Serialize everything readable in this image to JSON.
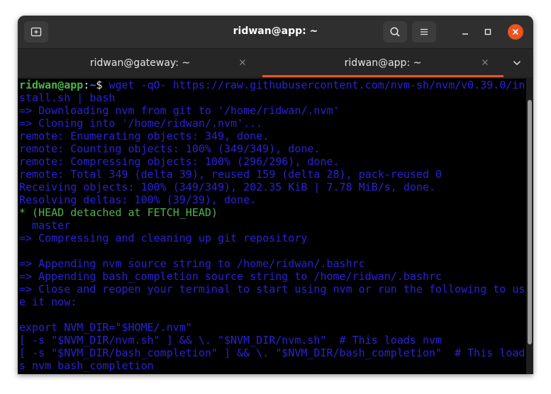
{
  "window": {
    "title": "ridwan@app: ~"
  },
  "header": {
    "newtab_icon": "new-tab-icon",
    "search_icon": "search-icon",
    "menu_icon": "hamburger-menu-icon"
  },
  "tabs": [
    {
      "label": "ridwan@gateway: ~",
      "active": false
    },
    {
      "label": "ridwan@app: ~",
      "active": true
    }
  ],
  "colors": {
    "accent": "#e95420",
    "terminal_bg": "#000000",
    "text_blue": "#2b21d6",
    "prompt_green": "#4eb44e"
  },
  "terminal": {
    "prompt_user": "ridwan@app",
    "prompt_sep": ":",
    "prompt_path": "~",
    "prompt_symbol": "$ ",
    "command_1": "wget -qO- https://raw.githubusercontent.com/nvm-sh/nvm/v0.39.0/in",
    "command_2": "stall.sh | bash",
    "lines": [
      "=> Downloading nvm from git to '/home/ridwan/.nvm'",
      "=> Cloning into '/home/ridwan/.nvm'...",
      "remote: Enumerating objects: 349, done.",
      "remote: Counting objects: 100% (349/349), done.",
      "remote: Compressing objects: 100% (296/296), done.",
      "remote: Total 349 (delta 39), reused 159 (delta 28), pack-reused 0",
      "Receiving objects: 100% (349/349), 202.35 KiB | 7.78 MiB/s, done.",
      "Resolving deltas: 100% (39/39), done.",
      "* (HEAD detached at FETCH_HEAD)",
      "  master",
      "=> Compressing and cleaning up git repository",
      "",
      "=> Appending nvm source string to /home/ridwan/.bashrc",
      "=> Appending bash_completion source string to /home/ridwan/.bashrc",
      "=> Close and reopen your terminal to start using nvm or run the following to us",
      "e it now:",
      "",
      "export NVM_DIR=\"$HOME/.nvm\"",
      "[ -s \"$NVM_DIR/nvm.sh\" ] && \\. \"$NVM_DIR/nvm.sh\"  # This loads nvm",
      "[ -s \"$NVM_DIR/bash_completion\" ] && \\. \"$NVM_DIR/bash_completion\"  # This load",
      "s nvm bash_completion"
    ]
  }
}
